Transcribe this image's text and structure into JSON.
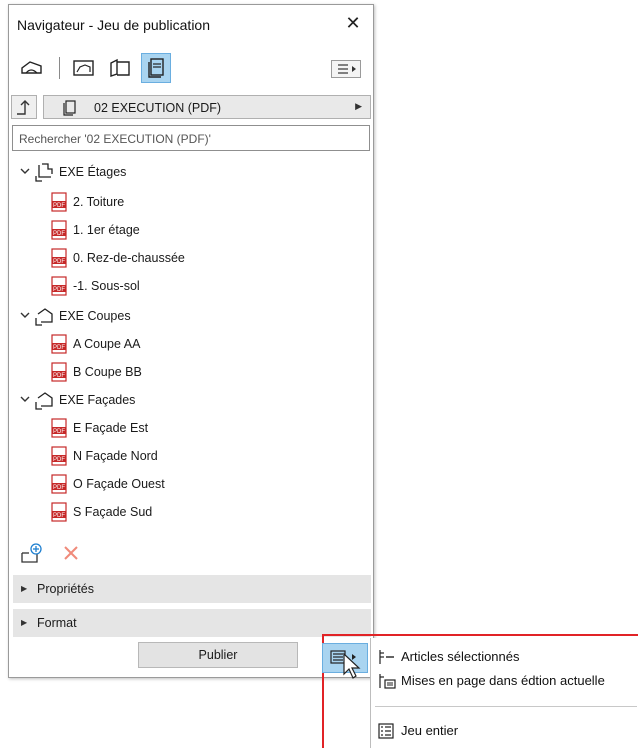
{
  "window": {
    "title": "Navigateur - Jeu de publication"
  },
  "publisher_set": {
    "name": "02 EXECUTION (PDF)"
  },
  "search": {
    "placeholder": "Rechercher '02 EXECUTION (PDF)'"
  },
  "tree": {
    "groups": [
      {
        "label": "EXE Étages",
        "items": [
          "2. Toiture",
          "1. 1er étage",
          "0. Rez-de-chaussée",
          "-1. Sous-sol"
        ]
      },
      {
        "label": "EXE Coupes",
        "items": [
          "A Coupe AA",
          "B Coupe BB"
        ]
      },
      {
        "label": "EXE Façades",
        "items": [
          "E Façade Est",
          "N Façade Nord",
          "O Façade Ouest",
          "S Façade Sud"
        ]
      }
    ]
  },
  "sections": {
    "properties": "Propriétés",
    "format": "Format"
  },
  "publish": {
    "label": "Publier"
  },
  "popup_menu": {
    "selected_items": "Articles sélectionnés",
    "layouts_in_edition": "Mises en page dans édtion actuelle",
    "entire_set": "Jeu entier"
  },
  "colors": {
    "accent": "#a9d4f0",
    "highlight_box": "#e12326",
    "pdf_red": "#c62828"
  }
}
